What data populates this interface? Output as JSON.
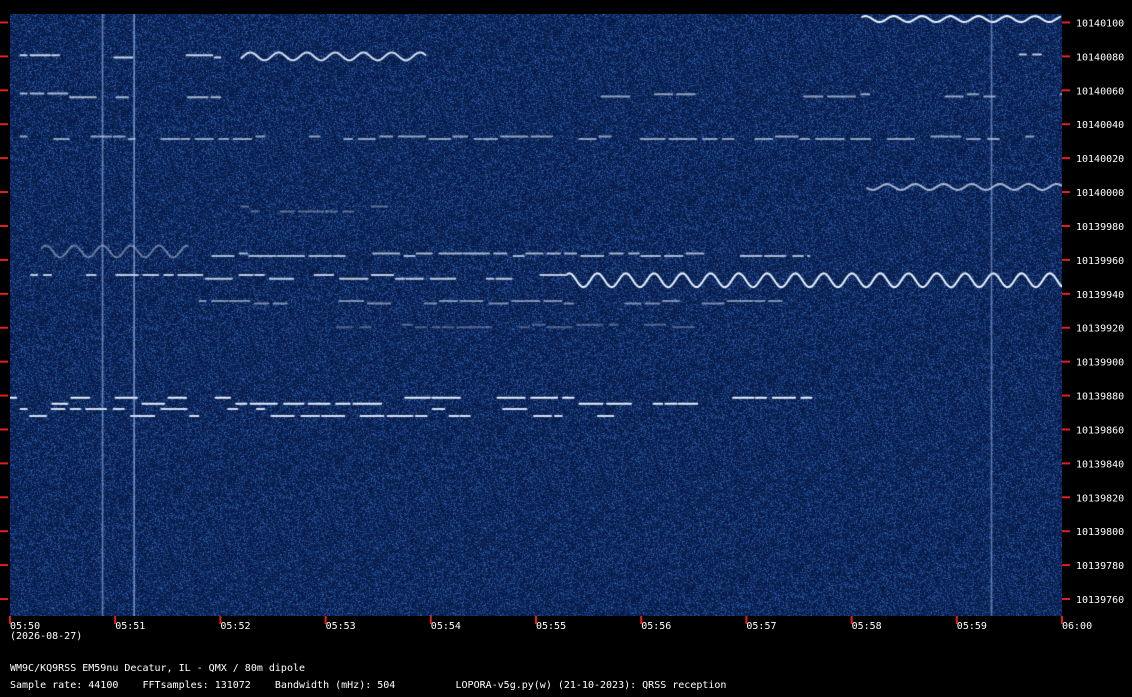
{
  "chart_data": {
    "type": "heatmap",
    "title": "",
    "date": "(2026-08-27)",
    "x_ticks": [
      "05:50",
      "05:51",
      "05:52",
      "05:53",
      "05:54",
      "05:55",
      "05:56",
      "05:57",
      "05:58",
      "05:59",
      "06:00"
    ],
    "y_ticks": [
      10140100,
      10140080,
      10140060,
      10140040,
      10140020,
      10140000,
      10139980,
      10139960,
      10139940,
      10139920,
      10139900,
      10139880,
      10139860,
      10139840,
      10139820,
      10139800,
      10139780,
      10139760
    ],
    "x_range_minutes": [
      0,
      10
    ],
    "y_range_hz": [
      10139750,
      10140105
    ],
    "colors": {
      "background": "#0a2350",
      "signal": "#e8f2ff",
      "tick": "#e02020",
      "text": "#ffffff"
    },
    "signals": [
      {
        "kind": "on_off",
        "freq": 10140080,
        "t_start": 0.1,
        "t_end": 2.0,
        "intensity": 0.85,
        "shift": 2
      },
      {
        "kind": "wavy",
        "freq": 10140080,
        "t_start": 2.2,
        "t_end": 3.95,
        "intensity": 0.9,
        "amplitude": 4
      },
      {
        "kind": "wavy",
        "freq": 10140102,
        "t_start": 8.1,
        "t_end": 10.0,
        "intensity": 1.0,
        "amplitude": 3
      },
      {
        "kind": "on_off",
        "freq": 10140080,
        "t_start": 9.6,
        "t_end": 9.8,
        "intensity": 0.8,
        "shift": 3
      },
      {
        "kind": "on_off",
        "freq": 10140057,
        "t_start": 0.1,
        "t_end": 2.0,
        "intensity": 0.7,
        "shift": 3
      },
      {
        "kind": "on_off",
        "freq": 10140057,
        "t_start": 5.5,
        "t_end": 10.0,
        "intensity": 0.6,
        "shift": 2
      },
      {
        "kind": "on_off",
        "freq": 10140032,
        "t_start": 0.1,
        "t_end": 10.0,
        "intensity": 0.6,
        "shift": 2
      },
      {
        "kind": "wavy",
        "freq": 10140003,
        "t_start": 8.15,
        "t_end": 10.0,
        "intensity": 0.7,
        "amplitude": 3
      },
      {
        "kind": "on_off",
        "freq": 10139990,
        "t_start": 2.2,
        "t_end": 3.9,
        "intensity": 0.35,
        "shift": 4
      },
      {
        "kind": "on_off",
        "freq": 10139963,
        "t_start": 1.8,
        "t_end": 7.6,
        "intensity": 0.7,
        "shift": 2
      },
      {
        "kind": "wavy",
        "freq": 10139965,
        "t_start": 0.3,
        "t_end": 1.7,
        "intensity": 0.4,
        "amplitude": 6
      },
      {
        "kind": "on_off",
        "freq": 10139950,
        "t_start": 0.2,
        "t_end": 5.3,
        "intensity": 0.8,
        "shift": 3
      },
      {
        "kind": "wavy",
        "freq": 10139948,
        "t_start": 5.3,
        "t_end": 10.0,
        "intensity": 1.0,
        "amplitude": 7
      },
      {
        "kind": "on_off",
        "freq": 10139935,
        "t_start": 1.8,
        "t_end": 7.4,
        "intensity": 0.5,
        "shift": 2
      },
      {
        "kind": "on_off",
        "freq": 10139921,
        "t_start": 2.3,
        "t_end": 6.5,
        "intensity": 0.3,
        "shift": 2
      },
      {
        "kind": "on_off",
        "freq": 10139877,
        "t_start": 0.0,
        "t_end": 7.75,
        "intensity": 1.0,
        "shift": 5
      },
      {
        "kind": "on_off",
        "freq": 10139870,
        "t_start": 0.1,
        "t_end": 5.8,
        "intensity": 0.9,
        "shift": 6
      },
      {
        "kind": "vline",
        "t": 0.88,
        "intensity": 0.55
      },
      {
        "kind": "vline",
        "t": 1.18,
        "intensity": 0.65
      },
      {
        "kind": "vline",
        "t": 9.33,
        "intensity": 0.5
      }
    ]
  },
  "footer": {
    "station": "WM9C/KQ9RSS EM59nu Decatur, IL - QMX / 80m dipole",
    "params": "Sample rate: 44100    FFTsamples: 131072    Bandwidth (mHz): 504          LOPORA-v5g.py(w) (21-10-2023): QRSS reception"
  }
}
